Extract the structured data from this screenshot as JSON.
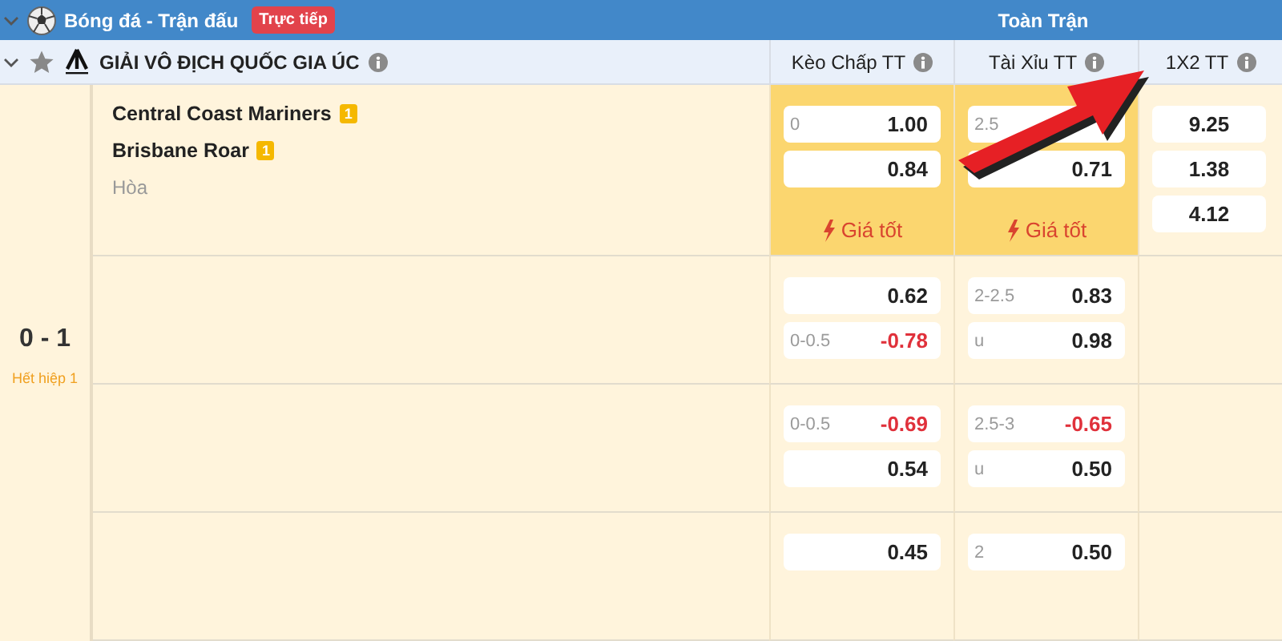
{
  "top_bar": {
    "title": "Bóng đá - Trận đấu",
    "live_badge": "Trực tiếp",
    "section": "Toàn Trận"
  },
  "league": {
    "name": "GIẢI VÔ ĐỊCH QUỐC GIA ÚC"
  },
  "columns": [
    "Kèo Chấp TT",
    "Tài Xỉu TT",
    "1X2 TT"
  ],
  "match": {
    "teams": [
      {
        "name": "Central Coast Mariners",
        "badge": "1"
      },
      {
        "name": "Brisbane Roar",
        "badge": "1"
      }
    ],
    "draw": "Hòa",
    "score": "0 - 1",
    "period": "Hết hiệp 1"
  },
  "rows": [
    {
      "highlight": true,
      "notes": [
        "Giá tốt",
        "Giá tốt"
      ],
      "handicap": [
        {
          "line": "0",
          "odds": "1.00",
          "negative": false
        },
        {
          "odds": "0.84",
          "negative": false
        }
      ],
      "total": [
        {
          "line": "2.5"
        },
        {
          "odds": "0.71",
          "negative": false
        }
      ],
      "x12": [
        {
          "odds": "9.25",
          "negative": false
        },
        {
          "odds": "1.38",
          "negative": false
        },
        {
          "odds": "4.12",
          "negative": false
        }
      ]
    },
    {
      "highlight": false,
      "handicap": [
        {
          "odds": "0.62",
          "negative": false
        },
        {
          "line": "0-0.5",
          "odds": "-0.78",
          "negative": true
        }
      ],
      "total": [
        {
          "line": "2-2.5",
          "odds": "0.83",
          "negative": false
        },
        {
          "line": "u",
          "odds": "0.98",
          "negative": false
        }
      ]
    },
    {
      "highlight": false,
      "handicap": [
        {
          "line": "0-0.5",
          "odds": "-0.69",
          "negative": true
        },
        {
          "odds": "0.54",
          "negative": false
        }
      ],
      "total": [
        {
          "line": "2.5-3",
          "odds": "-0.65",
          "negative": true
        },
        {
          "line": "u",
          "odds": "0.50",
          "negative": false
        }
      ]
    },
    {
      "highlight": false,
      "handicap": [
        {
          "odds": "0.45",
          "negative": false
        }
      ],
      "total": [
        {
          "line": "2",
          "odds": "0.50",
          "negative": false
        }
      ]
    }
  ]
}
